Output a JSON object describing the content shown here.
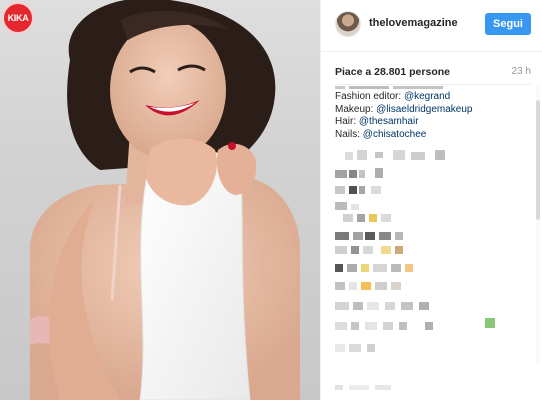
{
  "photo": {
    "badge_text": "KIKA",
    "colors": {
      "background": "#d5d5d5",
      "lips": "#c8102e",
      "hair": "#2b1d18"
    }
  },
  "header": {
    "username": "thelovemagazine",
    "follow_label": "Segui",
    "accent_color": "#3897f0"
  },
  "post": {
    "likes": "Piace a 28.801 persone",
    "timestamp": "23 h"
  },
  "caption": {
    "lines": [
      {
        "label": "Fashion editor: ",
        "mention": "@kegrand"
      },
      {
        "label": "Makeup: ",
        "mention": "@lisaeldridgemakeup"
      },
      {
        "label": "Hair: ",
        "mention": "@thesamhair"
      },
      {
        "label": "Nails: ",
        "mention": "@chisatochee"
      }
    ]
  }
}
